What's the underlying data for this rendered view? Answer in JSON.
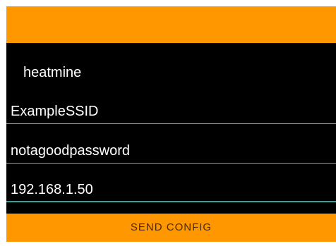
{
  "device": {
    "name": "heatmine"
  },
  "form": {
    "ssid": {
      "value": "ExampleSSID"
    },
    "password": {
      "value": "notagoodpassword"
    },
    "ip_address": {
      "value": "192.168.1.50"
    }
  },
  "actions": {
    "send_config_label": "SEND CONFIG"
  },
  "colors": {
    "accent": "#ff9800",
    "focus_underline": "#26a69a",
    "background": "#000000"
  }
}
